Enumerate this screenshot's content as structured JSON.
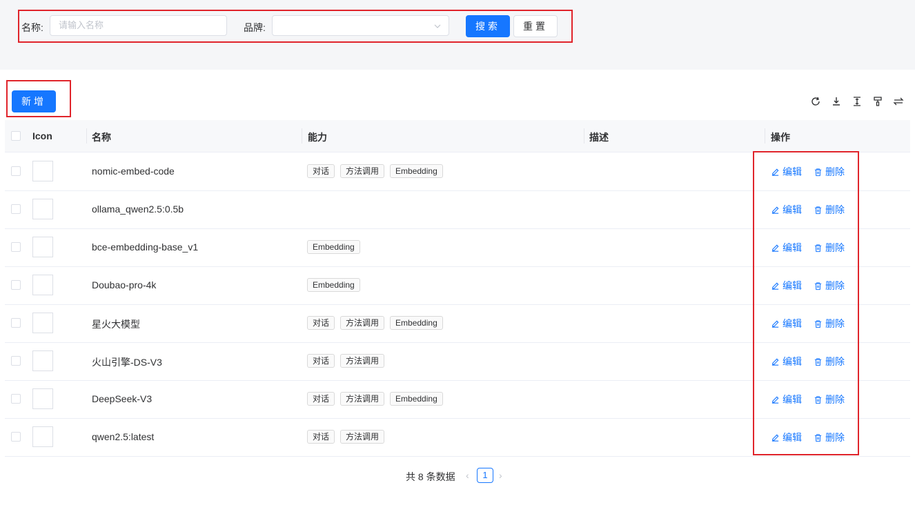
{
  "search": {
    "name_label": "名称:",
    "name_placeholder": "请输入名称",
    "brand_label": "品牌:",
    "brand_value": "",
    "search_button": "搜索",
    "reset_button": "重置"
  },
  "toolbar": {
    "add_button": "新增",
    "icons": [
      "refresh-icon",
      "download-icon",
      "column-height-icon",
      "format-painter-icon",
      "swap-icon"
    ]
  },
  "table": {
    "columns": [
      "Icon",
      "名称",
      "能力",
      "描述",
      "操作"
    ],
    "rows": [
      {
        "name": "nomic-embed-code",
        "tags": [
          "对话",
          "方法调用",
          "Embedding"
        ],
        "desc": ""
      },
      {
        "name": "ollama_qwen2.5:0.5b",
        "tags": [],
        "desc": ""
      },
      {
        "name": "bce-embedding-base_v1",
        "tags": [
          "Embedding"
        ],
        "desc": ""
      },
      {
        "name": "Doubao-pro-4k",
        "tags": [
          "Embedding"
        ],
        "desc": ""
      },
      {
        "name": "星火大模型",
        "tags": [
          "对话",
          "方法调用",
          "Embedding"
        ],
        "desc": ""
      },
      {
        "name": "火山引擎-DS-V3",
        "tags": [
          "对话",
          "方法调用"
        ],
        "desc": ""
      },
      {
        "name": "DeepSeek-V3",
        "tags": [
          "对话",
          "方法调用",
          "Embedding"
        ],
        "desc": ""
      },
      {
        "name": "qwen2.5:latest",
        "tags": [
          "对话",
          "方法调用"
        ],
        "desc": ""
      }
    ],
    "edit_label": "编辑",
    "delete_label": "删除"
  },
  "pagination": {
    "total_text": "共 8 条数据",
    "current_page": "1",
    "prev": "‹",
    "next": "›"
  },
  "colors": {
    "primary": "#1677ff",
    "highlight_border": "#e0242b"
  }
}
